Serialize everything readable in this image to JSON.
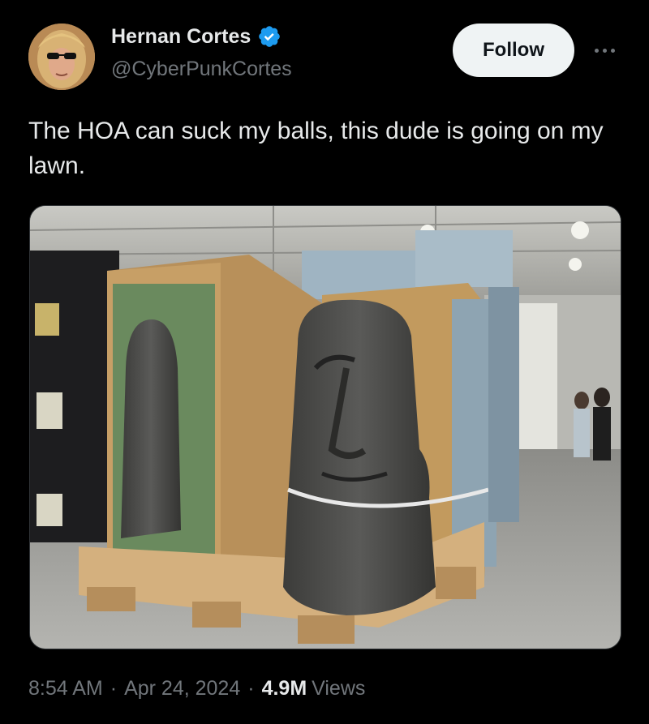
{
  "author": {
    "display_name": "Hernan Cortes",
    "handle": "@CyberPunkCortes",
    "verified": true,
    "verified_color": "#1d9bf0"
  },
  "actions": {
    "follow_label": "Follow",
    "more_icon": "more-horizontal-icon"
  },
  "tweet": {
    "text": "The HOA can suck my balls, this dude is going on my lawn."
  },
  "media": {
    "type": "photo"
  },
  "meta": {
    "time": "8:54 AM",
    "separator": "·",
    "date": "Apr 24, 2024",
    "views_count": "4.9M",
    "views_label": "Views"
  }
}
